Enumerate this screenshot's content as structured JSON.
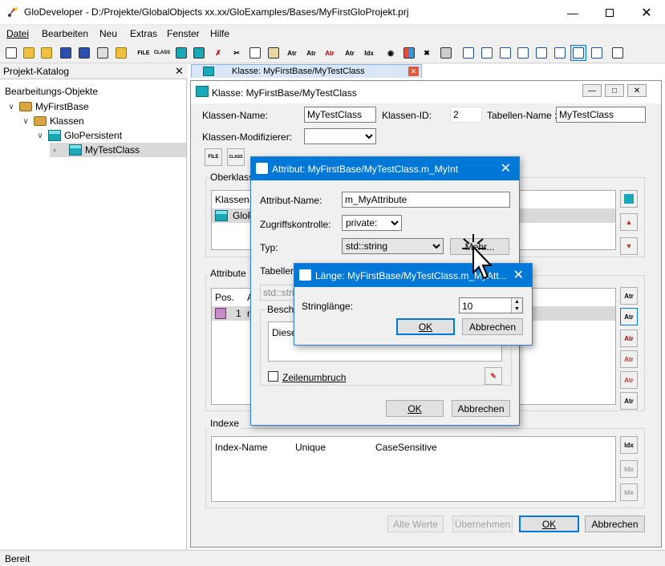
{
  "window": {
    "title": "GloDeveloper - D:/Projekte/GlobalObjects xx.xx/GloExamples/Bases/MyFirstGloProjekt.prj"
  },
  "menu": [
    "Datei",
    "Bearbeiten",
    "Neu",
    "Extras",
    "Fenster",
    "Hilfe"
  ],
  "toolbar_icons": [
    "new-file",
    "open-folder",
    "open-folder-2",
    "save",
    "save-as",
    "properties",
    "open",
    "file-class",
    "class",
    "attr",
    "find",
    "cut",
    "copy",
    "paste",
    "attr-copy",
    "attr-move",
    "attr-delete",
    "attr-add",
    "index",
    "globe",
    "tiles",
    "tools",
    "build",
    "frame-1",
    "frame-2",
    "frame-3",
    "frame-4",
    "frame-5",
    "frame-6",
    "frame-7",
    "frame-8",
    "book"
  ],
  "left_panel": {
    "header": "Projekt-Katalog",
    "root_label": "Bearbeitungs-Objekte",
    "tree": [
      {
        "label": "MyFirstBase",
        "level": 1
      },
      {
        "label": "Klassen",
        "level": 2
      },
      {
        "label": "GloPersistent",
        "level": 3
      },
      {
        "label": "MyTestClass",
        "level": 4,
        "selected": true
      }
    ]
  },
  "doc_tab": {
    "label": "Klasse: MyFirstBase/MyTestClass"
  },
  "class_window": {
    "title": "Klasse: MyFirstBase/MyTestClass",
    "class_name_label": "Klassen-Name:",
    "class_name_value": "MyTestClass",
    "class_id_label": "Klassen-ID:",
    "class_id_value": "2",
    "table_name_label": "Tabellen-Name :",
    "table_name_value": "MyTestClass",
    "modifier_label": "Klassen-Modifizierer:",
    "modifier_value": "",
    "file_btn": "FILE",
    "class_btn": "CLASS",
    "superclass_group": "Oberklasse",
    "superclass_col": "Klassen-",
    "superclass_row": "GloP",
    "attr_group": "Attribute",
    "attr_col_pos": "Pos.",
    "attr_col_a": "A",
    "attr_row_pos": "1",
    "attr_row_a": "n",
    "index_group": "Indexe",
    "index_cols": [
      "Index-Name",
      "Unique",
      "CaseSensitive"
    ],
    "buttons": {
      "old": "Alte Werte",
      "apply": "Übernehmen",
      "ok": "OK",
      "cancel": "Abbrechen"
    }
  },
  "attr_dialog": {
    "title": "Attribut: MyFirstBase/MyTestClass.m_MyInt",
    "name_label": "Attribut-Name:",
    "name_value": "m_MyAttribute",
    "access_label": "Zugriffskontrolle:",
    "access_value": "private:",
    "type_label": "Typ:",
    "type_value": "std::string",
    "more_btn": "Mehr...",
    "table_label": "Tabellen",
    "table_value": "std::stri",
    "desc_label": "Beschr",
    "desc_value": "Diese",
    "wrap_label": "Zeilenumbruch",
    "ok": "OK",
    "cancel": "Abbrechen"
  },
  "length_dialog": {
    "title": "Länge: MyFirstBase/MyTestClass.m_MyAtt...",
    "label": "Stringlänge:",
    "value": "10",
    "ok": "OK",
    "cancel": "Abbrechen"
  },
  "status": "Bereit",
  "colors": {
    "accent": "#0078d7",
    "titlebar_dialog": "#0078d7",
    "selection": "#d9d9d9"
  }
}
